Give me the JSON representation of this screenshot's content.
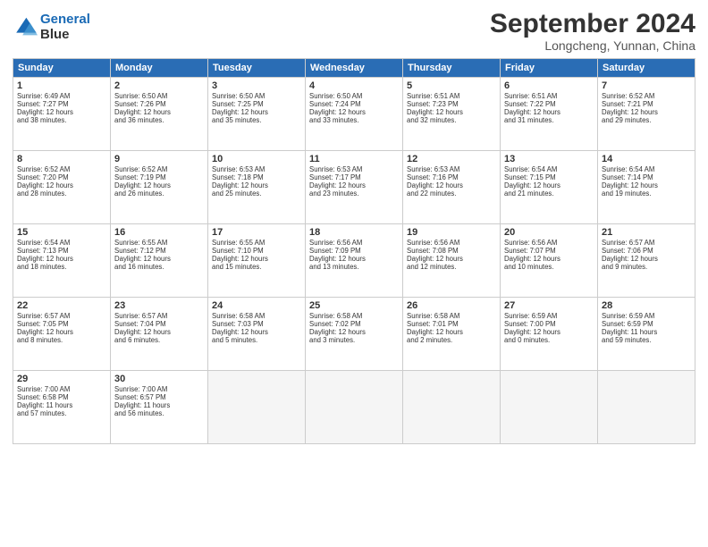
{
  "logo": {
    "line1": "General",
    "line2": "Blue"
  },
  "title": "September 2024",
  "location": "Longcheng, Yunnan, China",
  "headers": [
    "Sunday",
    "Monday",
    "Tuesday",
    "Wednesday",
    "Thursday",
    "Friday",
    "Saturday"
  ],
  "weeks": [
    [
      {
        "day": 1,
        "lines": [
          "Sunrise: 6:49 AM",
          "Sunset: 7:27 PM",
          "Daylight: 12 hours",
          "and 38 minutes."
        ]
      },
      {
        "day": 2,
        "lines": [
          "Sunrise: 6:50 AM",
          "Sunset: 7:26 PM",
          "Daylight: 12 hours",
          "and 36 minutes."
        ]
      },
      {
        "day": 3,
        "lines": [
          "Sunrise: 6:50 AM",
          "Sunset: 7:25 PM",
          "Daylight: 12 hours",
          "and 35 minutes."
        ]
      },
      {
        "day": 4,
        "lines": [
          "Sunrise: 6:50 AM",
          "Sunset: 7:24 PM",
          "Daylight: 12 hours",
          "and 33 minutes."
        ]
      },
      {
        "day": 5,
        "lines": [
          "Sunrise: 6:51 AM",
          "Sunset: 7:23 PM",
          "Daylight: 12 hours",
          "and 32 minutes."
        ]
      },
      {
        "day": 6,
        "lines": [
          "Sunrise: 6:51 AM",
          "Sunset: 7:22 PM",
          "Daylight: 12 hours",
          "and 31 minutes."
        ]
      },
      {
        "day": 7,
        "lines": [
          "Sunrise: 6:52 AM",
          "Sunset: 7:21 PM",
          "Daylight: 12 hours",
          "and 29 minutes."
        ]
      }
    ],
    [
      {
        "day": 8,
        "lines": [
          "Sunrise: 6:52 AM",
          "Sunset: 7:20 PM",
          "Daylight: 12 hours",
          "and 28 minutes."
        ]
      },
      {
        "day": 9,
        "lines": [
          "Sunrise: 6:52 AM",
          "Sunset: 7:19 PM",
          "Daylight: 12 hours",
          "and 26 minutes."
        ]
      },
      {
        "day": 10,
        "lines": [
          "Sunrise: 6:53 AM",
          "Sunset: 7:18 PM",
          "Daylight: 12 hours",
          "and 25 minutes."
        ]
      },
      {
        "day": 11,
        "lines": [
          "Sunrise: 6:53 AM",
          "Sunset: 7:17 PM",
          "Daylight: 12 hours",
          "and 23 minutes."
        ]
      },
      {
        "day": 12,
        "lines": [
          "Sunrise: 6:53 AM",
          "Sunset: 7:16 PM",
          "Daylight: 12 hours",
          "and 22 minutes."
        ]
      },
      {
        "day": 13,
        "lines": [
          "Sunrise: 6:54 AM",
          "Sunset: 7:15 PM",
          "Daylight: 12 hours",
          "and 21 minutes."
        ]
      },
      {
        "day": 14,
        "lines": [
          "Sunrise: 6:54 AM",
          "Sunset: 7:14 PM",
          "Daylight: 12 hours",
          "and 19 minutes."
        ]
      }
    ],
    [
      {
        "day": 15,
        "lines": [
          "Sunrise: 6:54 AM",
          "Sunset: 7:13 PM",
          "Daylight: 12 hours",
          "and 18 minutes."
        ]
      },
      {
        "day": 16,
        "lines": [
          "Sunrise: 6:55 AM",
          "Sunset: 7:12 PM",
          "Daylight: 12 hours",
          "and 16 minutes."
        ]
      },
      {
        "day": 17,
        "lines": [
          "Sunrise: 6:55 AM",
          "Sunset: 7:10 PM",
          "Daylight: 12 hours",
          "and 15 minutes."
        ]
      },
      {
        "day": 18,
        "lines": [
          "Sunrise: 6:56 AM",
          "Sunset: 7:09 PM",
          "Daylight: 12 hours",
          "and 13 minutes."
        ]
      },
      {
        "day": 19,
        "lines": [
          "Sunrise: 6:56 AM",
          "Sunset: 7:08 PM",
          "Daylight: 12 hours",
          "and 12 minutes."
        ]
      },
      {
        "day": 20,
        "lines": [
          "Sunrise: 6:56 AM",
          "Sunset: 7:07 PM",
          "Daylight: 12 hours",
          "and 10 minutes."
        ]
      },
      {
        "day": 21,
        "lines": [
          "Sunrise: 6:57 AM",
          "Sunset: 7:06 PM",
          "Daylight: 12 hours",
          "and 9 minutes."
        ]
      }
    ],
    [
      {
        "day": 22,
        "lines": [
          "Sunrise: 6:57 AM",
          "Sunset: 7:05 PM",
          "Daylight: 12 hours",
          "and 8 minutes."
        ]
      },
      {
        "day": 23,
        "lines": [
          "Sunrise: 6:57 AM",
          "Sunset: 7:04 PM",
          "Daylight: 12 hours",
          "and 6 minutes."
        ]
      },
      {
        "day": 24,
        "lines": [
          "Sunrise: 6:58 AM",
          "Sunset: 7:03 PM",
          "Daylight: 12 hours",
          "and 5 minutes."
        ]
      },
      {
        "day": 25,
        "lines": [
          "Sunrise: 6:58 AM",
          "Sunset: 7:02 PM",
          "Daylight: 12 hours",
          "and 3 minutes."
        ]
      },
      {
        "day": 26,
        "lines": [
          "Sunrise: 6:58 AM",
          "Sunset: 7:01 PM",
          "Daylight: 12 hours",
          "and 2 minutes."
        ]
      },
      {
        "day": 27,
        "lines": [
          "Sunrise: 6:59 AM",
          "Sunset: 7:00 PM",
          "Daylight: 12 hours",
          "and 0 minutes."
        ]
      },
      {
        "day": 28,
        "lines": [
          "Sunrise: 6:59 AM",
          "Sunset: 6:59 PM",
          "Daylight: 11 hours",
          "and 59 minutes."
        ]
      }
    ],
    [
      {
        "day": 29,
        "lines": [
          "Sunrise: 7:00 AM",
          "Sunset: 6:58 PM",
          "Daylight: 11 hours",
          "and 57 minutes."
        ]
      },
      {
        "day": 30,
        "lines": [
          "Sunrise: 7:00 AM",
          "Sunset: 6:57 PM",
          "Daylight: 11 hours",
          "and 56 minutes."
        ]
      },
      null,
      null,
      null,
      null,
      null
    ]
  ]
}
